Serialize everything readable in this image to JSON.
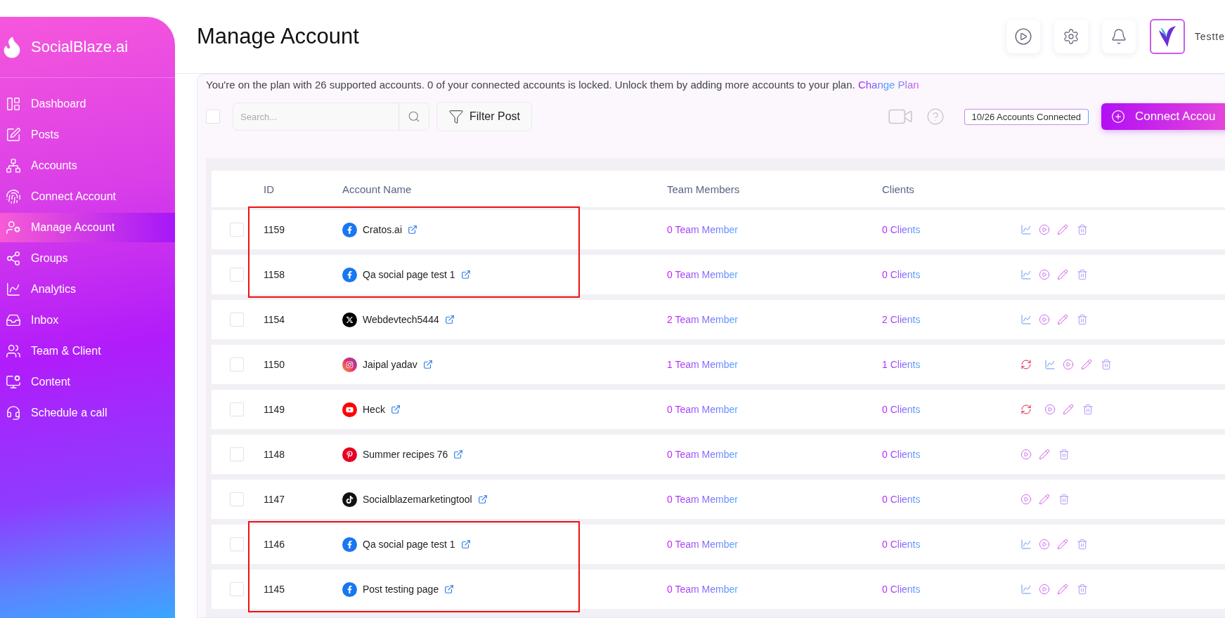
{
  "sidebar": {
    "brand": "SocialBlaze.ai",
    "items": [
      {
        "label": "Dashboard",
        "selected": false
      },
      {
        "label": "Posts",
        "selected": false
      },
      {
        "label": "Accounts",
        "selected": false
      },
      {
        "label": "Connect Account",
        "selected": false
      },
      {
        "label": "Manage Account",
        "selected": true
      },
      {
        "label": "Groups",
        "selected": false
      },
      {
        "label": "Analytics",
        "selected": false
      },
      {
        "label": "Inbox",
        "selected": false
      },
      {
        "label": "Team & Client",
        "selected": false
      },
      {
        "label": "Content",
        "selected": false
      },
      {
        "label": "Schedule a call",
        "selected": false
      }
    ]
  },
  "header": {
    "title": "Manage Account",
    "user_name": "Testte"
  },
  "plan_notice": {
    "text": "You're on the plan with 26 supported accounts. 0 of your connected accounts is locked. Unlock them by adding more accounts to your plan.",
    "link": "Change Plan"
  },
  "toolbar": {
    "select_all": {
      "checked": false
    },
    "search": {
      "placeholder": "Search..."
    },
    "filter_button": "Filter Post",
    "accounts_badge": "10/26 Accounts Connected",
    "connect_button": "Connect Accou"
  },
  "table": {
    "columns": [
      "ID",
      "Account Name",
      "Team Members",
      "Clients"
    ],
    "rows": [
      {
        "id": "1159",
        "kind": "facebook",
        "name": "Cratos.ai",
        "team": "0 Team Member",
        "clients": "0 Clients",
        "checked": false,
        "marked": true,
        "actions": [
          {
            "kind": "analytics"
          },
          {
            "kind": "play"
          },
          {
            "kind": "edit"
          },
          {
            "kind": "delete"
          }
        ]
      },
      {
        "id": "1158",
        "kind": "facebook",
        "name": "Qa social page test 1",
        "team": "0 Team Member",
        "clients": "0 Clients",
        "checked": false,
        "marked": true,
        "actions": [
          {
            "kind": "analytics"
          },
          {
            "kind": "play"
          },
          {
            "kind": "edit"
          },
          {
            "kind": "delete"
          }
        ]
      },
      {
        "id": "1154",
        "kind": "x",
        "name": "Webdevtech5444",
        "team": "2 Team Member",
        "clients": "2 Clients",
        "checked": false,
        "marked": false,
        "actions": [
          {
            "kind": "analytics"
          },
          {
            "kind": "play"
          },
          {
            "kind": "edit"
          },
          {
            "kind": "delete"
          }
        ]
      },
      {
        "id": "1150",
        "kind": "instagram",
        "name": "Jaipal yadav",
        "team": "1 Team Member",
        "clients": "1 Clients",
        "checked": false,
        "marked": false,
        "actions": [
          {
            "kind": "refresh"
          },
          {
            "kind": "analytics"
          },
          {
            "kind": "play"
          },
          {
            "kind": "edit"
          },
          {
            "kind": "delete"
          }
        ]
      },
      {
        "id": "1149",
        "kind": "youtube",
        "name": "Heck",
        "team": "0 Team Member",
        "clients": "0 Clients",
        "checked": false,
        "marked": false,
        "actions": [
          {
            "kind": "refresh"
          },
          {
            "kind": "play"
          },
          {
            "kind": "edit"
          },
          {
            "kind": "delete"
          }
        ]
      },
      {
        "id": "1148",
        "kind": "pinterest",
        "name": "Summer recipes 76",
        "team": "0 Team Member",
        "clients": "0 Clients",
        "checked": false,
        "marked": false,
        "actions": [
          {
            "kind": "play"
          },
          {
            "kind": "edit"
          },
          {
            "kind": "delete"
          }
        ]
      },
      {
        "id": "1147",
        "kind": "tiktok",
        "name": "Socialblazemarketingtool",
        "team": "0 Team Member",
        "clients": "0 Clients",
        "checked": false,
        "marked": false,
        "actions": [
          {
            "kind": "play"
          },
          {
            "kind": "edit"
          },
          {
            "kind": "delete"
          }
        ]
      },
      {
        "id": "1146",
        "kind": "facebook",
        "name": "Qa social page test 1",
        "team": "0 Team Member",
        "clients": "0 Clients",
        "checked": false,
        "marked": true,
        "actions": [
          {
            "kind": "analytics"
          },
          {
            "kind": "play"
          },
          {
            "kind": "edit"
          },
          {
            "kind": "delete"
          }
        ]
      },
      {
        "id": "1145",
        "kind": "facebook",
        "name": "Post testing page",
        "team": "0 Team Member",
        "clients": "0 Clients",
        "checked": false,
        "marked": true,
        "actions": [
          {
            "kind": "analytics"
          },
          {
            "kind": "play"
          },
          {
            "kind": "edit"
          },
          {
            "kind": "delete"
          }
        ]
      }
    ]
  }
}
